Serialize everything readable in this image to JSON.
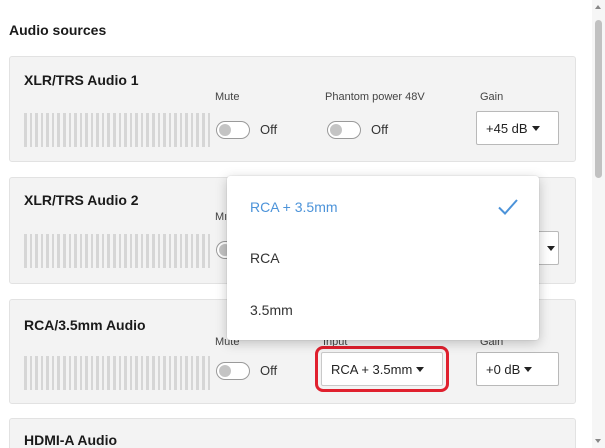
{
  "section": {
    "title": "Audio sources"
  },
  "cards": {
    "xlr1": {
      "title": "XLR/TRS Audio 1",
      "mute_label": "Mute",
      "mute_state": "Off",
      "phantom_label": "Phantom power 48V",
      "phantom_state": "Off",
      "gain_label": "Gain",
      "gain_value": "+45 dB"
    },
    "xlr2": {
      "title": "XLR/TRS Audio 2",
      "mute_label_partial": "Mı"
    },
    "rca": {
      "title": "RCA/3.5mm Audio",
      "mute_label": "Mute",
      "mute_state": "Off",
      "input_label": "Input",
      "input_value": "RCA + 3.5mm",
      "gain_label": "Gain",
      "gain_value": "+0 dB"
    },
    "hdmi": {
      "title": "HDMI-A Audio"
    }
  },
  "dropdown": {
    "options": [
      {
        "label": "RCA + 3.5mm",
        "selected": true
      },
      {
        "label": "RCA",
        "selected": false
      },
      {
        "label": "3.5mm",
        "selected": false
      }
    ]
  },
  "colors": {
    "selected_option": "#4c93d9",
    "highlight_outline": "#e0202e",
    "card_background": "#f3f3f3"
  },
  "icons": {
    "check": "check-icon",
    "caret": "caret-down-icon"
  }
}
